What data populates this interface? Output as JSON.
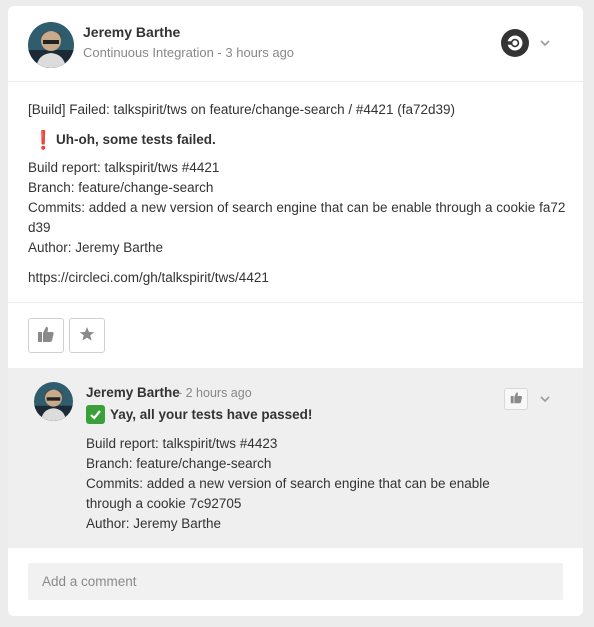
{
  "post": {
    "author": "Jeremy Barthe",
    "app_name": "Continuous Integration",
    "time_separator": " - ",
    "time": "3 hours ago",
    "title": "[Build] Failed: talkspirit/tws on feature/change-search / #4421 (fa72d39)",
    "failure_icon": "exclamation-icon",
    "failure_text": "Uh-oh, some tests failed.",
    "build_report": "Build report: talkspirit/tws #4421",
    "branch": "Branch: feature/change-search",
    "commits": "Commits: added a new version of search engine that can be enable through a cookie fa72d39",
    "author_line": "Author: Jeremy Barthe",
    "link": "https://circleci.com/gh/talkspirit/tws/4421"
  },
  "actions": {
    "like_icon": "thumbs-up-icon",
    "star_icon": "star-icon"
  },
  "comment": {
    "author": "Jeremy Barthe",
    "time": "- 2 hours ago",
    "success_icon": "check-mark-icon",
    "success_text": "Yay, all your tests have passed!",
    "build_report": "Build report: talkspirit/tws #4423",
    "branch": "Branch: feature/change-search",
    "commits": "Commits: added a new version of search engine that can be enable through a cookie 7c92705",
    "author_line": "Author: Jeremy Barthe"
  },
  "composer": {
    "placeholder": "Add a comment"
  },
  "colors": {
    "failure_red": "#e0262c",
    "success_green": "#3aa13a",
    "comment_bg": "#efefef"
  }
}
